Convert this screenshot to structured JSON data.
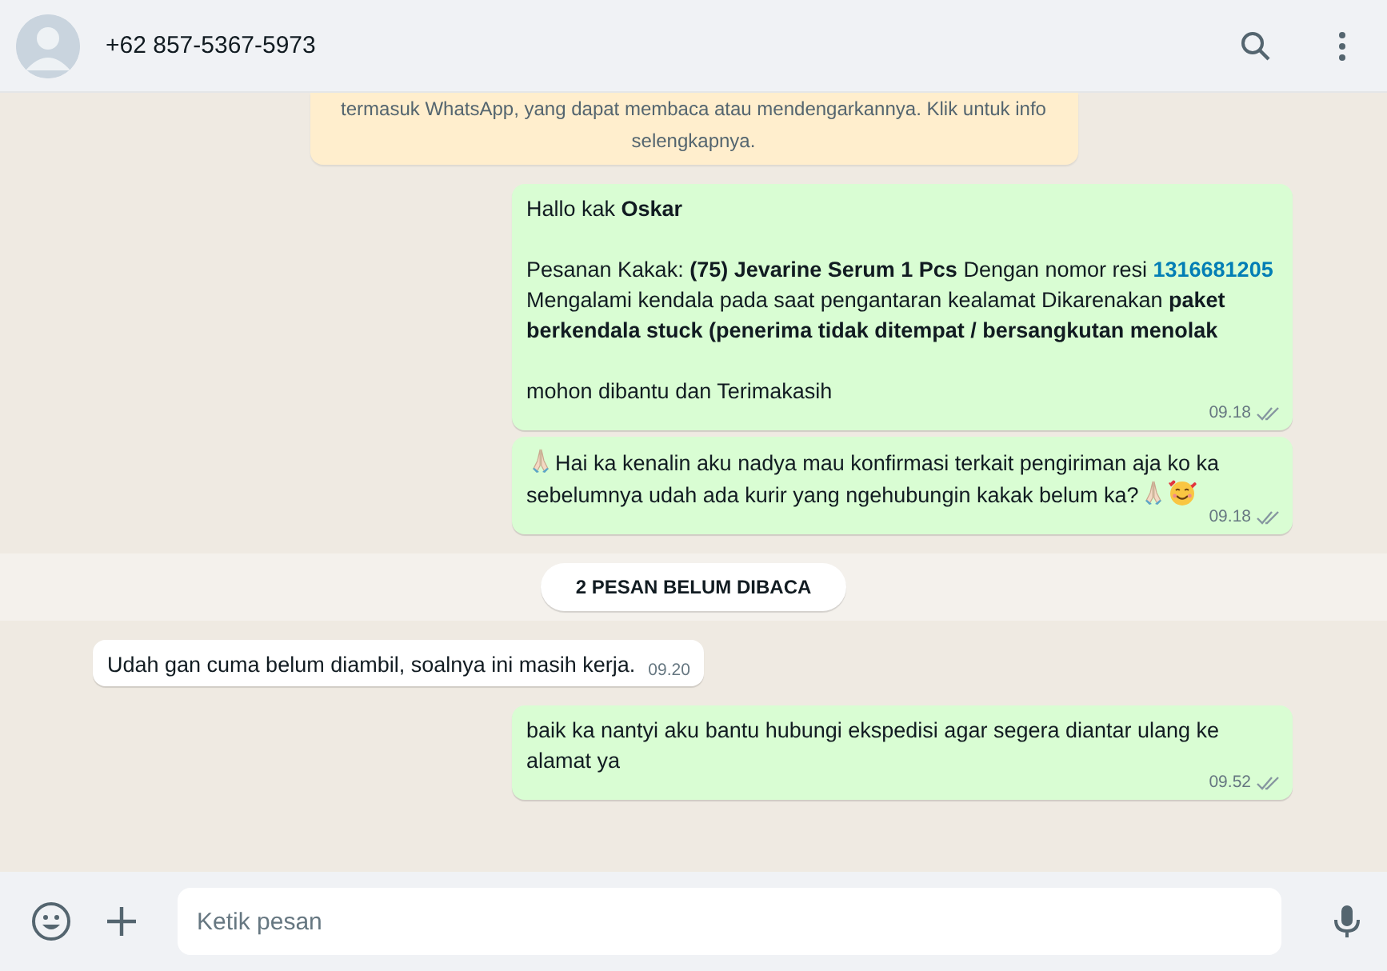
{
  "header": {
    "contact": "+62 857-5367-5973"
  },
  "notice": {
    "text": "termasuk WhatsApp, yang dapat membaca atau mendengarkannya. Klik untuk info selengkapnya."
  },
  "messages": [
    {
      "kind": "outgoing",
      "time": "09.18",
      "read": false,
      "paragraphs": [
        [
          {
            "kind": "text",
            "text": "Hallo kak **Oskar**"
          }
        ],
        [
          {
            "kind": "text",
            "text": "Pesanan Kakak: **(75) Jevarine Serum 1 Pcs** Dengan nomor resi "
          },
          {
            "kind": "link",
            "text": "1316681205"
          },
          {
            "kind": "text",
            "text": " Mengalami kendala pada saat pengantaran kealamat Dikarenakan **paket berkendala stuck (penerima tidak ditempat / bersangkutan menolak**"
          }
        ],
        [
          {
            "kind": "text",
            "text": " mohon dibantu dan Terimakasih"
          }
        ]
      ]
    },
    {
      "kind": "outgoing",
      "time": "09.18",
      "read": false,
      "paragraphs": [
        [
          {
            "kind": "pray"
          },
          {
            "kind": "text",
            "text": "Hai ka kenalin aku nadya mau konfirmasi terkait pengiriman aja ko ka sebelumnya udah ada kurir yang ngehubungin kakak belum ka?"
          },
          {
            "kind": "pray"
          },
          {
            "kind": "smile"
          }
        ]
      ]
    },
    {
      "kind": "divider",
      "text": "2 PESAN BELUM DIBACA"
    },
    {
      "kind": "incoming",
      "time": "09.20",
      "paragraphs": [
        [
          {
            "kind": "text",
            "text": "Udah gan cuma belum diambil, soalnya ini masih kerja."
          }
        ]
      ]
    },
    {
      "kind": "outgoing",
      "time": "09.52",
      "read": false,
      "paragraphs": [
        [
          {
            "kind": "text",
            "text": "baik ka nantyi aku bantu hubungi ekspedisi agar segera diantar ulang ke alamat ya"
          }
        ]
      ]
    }
  ],
  "composer": {
    "placeholder": "Ketik pesan"
  }
}
